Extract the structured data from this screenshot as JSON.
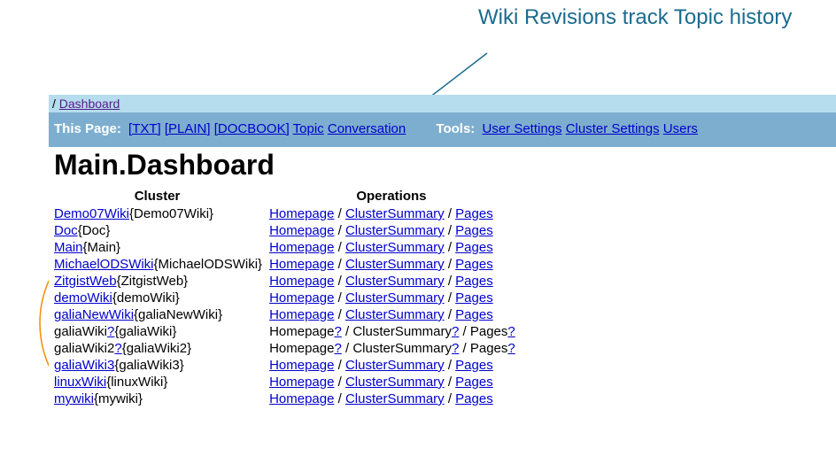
{
  "annotation": {
    "text": "Wiki Revisions track Topic history"
  },
  "breadcrumb": {
    "slash": "/",
    "dashboard": "Dashboard"
  },
  "toolbar": {
    "this_page_label": "This Page:",
    "txt": "[TXT]",
    "plain": "[PLAIN]",
    "docbook": "[DOCBOOK]",
    "topic": "Topic",
    "conversation": "Conversation",
    "tools_label": "Tools:",
    "user_settings": "User Settings",
    "cluster_settings": "Cluster Settings",
    "users": "Users"
  },
  "heading": "Main.Dashboard",
  "table": {
    "col_cluster": "Cluster",
    "col_operations": "Operations",
    "sep": " / ",
    "q": "?",
    "homepage": "Homepage",
    "cluster_summary": "ClusterSummary",
    "pages": "Pages",
    "rows": [
      {
        "link": "Demo07Wiki",
        "brace": "{Demo07Wiki}",
        "hasLink": true,
        "unknown": false
      },
      {
        "link": "Doc",
        "brace": "{Doc}",
        "hasLink": true,
        "unknown": false
      },
      {
        "link": "Main",
        "brace": "{Main}",
        "hasLink": true,
        "unknown": false
      },
      {
        "link": "MichaelODSWiki",
        "brace": "{MichaelODSWiki}",
        "hasLink": true,
        "unknown": false
      },
      {
        "link": "ZitgistWeb",
        "brace": "{ZitgistWeb}",
        "hasLink": true,
        "unknown": false
      },
      {
        "link": "demoWiki",
        "brace": "{demoWiki}",
        "hasLink": true,
        "unknown": false
      },
      {
        "link": "galiaNewWiki",
        "brace": "{galiaNewWiki}",
        "hasLink": true,
        "unknown": false
      },
      {
        "link": "galiaWiki",
        "brace": "{galiaWiki}",
        "hasLink": false,
        "unknown": true
      },
      {
        "link": "galiaWiki2",
        "brace": "{galiaWiki2}",
        "hasLink": false,
        "unknown": true
      },
      {
        "link": "galiaWiki3",
        "brace": "{galiaWiki3}",
        "hasLink": true,
        "unknown": false
      },
      {
        "link": "linuxWiki",
        "brace": "{linuxWiki}",
        "hasLink": true,
        "unknown": false
      },
      {
        "link": "mywiki",
        "brace": "{mywiki}",
        "hasLink": true,
        "unknown": false
      }
    ]
  }
}
